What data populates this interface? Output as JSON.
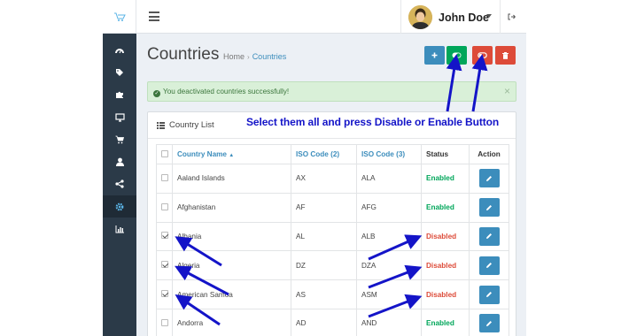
{
  "user": {
    "name": "John Doe"
  },
  "page": {
    "title": "Countries",
    "breadcrumb": {
      "home": "Home",
      "current": "Countries"
    }
  },
  "alert": {
    "message": "You deactivated countries successfully!",
    "close": "×"
  },
  "annotation": "Select them all and press Disable or Enable Button",
  "panel": {
    "title": "Country List"
  },
  "table": {
    "headers": {
      "name": "Country Name",
      "iso2": "ISO Code (2)",
      "iso3": "ISO Code (3)",
      "status": "Status",
      "action": "Action"
    },
    "rows": [
      {
        "name": "Aaland Islands",
        "iso2": "AX",
        "iso3": "ALA",
        "status": "Enabled",
        "checked": false
      },
      {
        "name": "Afghanistan",
        "iso2": "AF",
        "iso3": "AFG",
        "status": "Enabled",
        "checked": false
      },
      {
        "name": "Albania",
        "iso2": "AL",
        "iso3": "ALB",
        "status": "Disabled",
        "checked": true
      },
      {
        "name": "Algeria",
        "iso2": "DZ",
        "iso3": "DZA",
        "status": "Disabled",
        "checked": true
      },
      {
        "name": "American Samoa",
        "iso2": "AS",
        "iso3": "ASM",
        "status": "Disabled",
        "checked": true
      },
      {
        "name": "Andorra",
        "iso2": "AD",
        "iso3": "AND",
        "status": "Enabled",
        "checked": false
      }
    ]
  },
  "colors": {
    "sidebar": "#2b3a48",
    "primary": "#3c8dbc",
    "success": "#00a65a",
    "danger": "#dd4b39",
    "annotation": "#1414c8"
  },
  "icons": {
    "sidebar": [
      "dashboard-icon",
      "tags-icon",
      "puzzle-icon",
      "desktop-icon",
      "cart-icon",
      "user-icon",
      "share-icon",
      "gear-icon",
      "bar-chart-icon"
    ],
    "toolbar": [
      "plus-icon",
      "toggle-on-icon",
      "toggle-off-icon",
      "trash-icon"
    ]
  }
}
